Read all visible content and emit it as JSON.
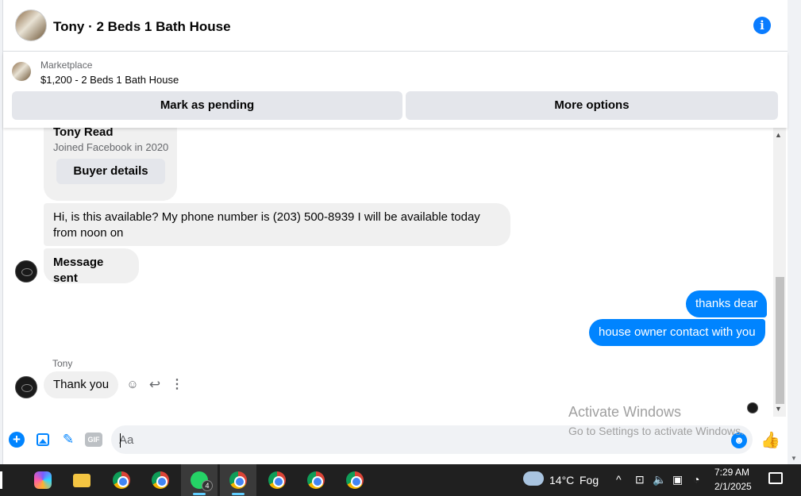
{
  "header": {
    "title": "Tony · 2 Beds 1 Bath House",
    "info_icon": "info-icon"
  },
  "marketplace": {
    "label": "Marketplace",
    "listing": "$1,200 - 2 Beds 1 Bath House",
    "mark_pending": "Mark as pending",
    "more_options": "More options"
  },
  "profile_card": {
    "name": "Tony Read",
    "joined": "Joined Facebook in 2020",
    "buyer_details": "Buyer details"
  },
  "messages": {
    "availability": "Hi, is this available? My phone number is (203) 500-8939 I will be available today from noon on",
    "message_sent": "Message sent",
    "thanks_dear": "thanks dear",
    "house_owner": "house owner contact with you",
    "sender_name": "Tony",
    "thank_you": "Thank you"
  },
  "composer": {
    "placeholder": "Aa",
    "gif_label": "GIF"
  },
  "watermark": {
    "title": "Activate Windows",
    "subtitle": "Go to Settings to activate Windows."
  },
  "taskbar": {
    "whatsapp_badge": "4",
    "temperature": "14°C",
    "condition": "Fog",
    "time": "7:29 AM",
    "date": "2/1/2025"
  },
  "colors": {
    "accent": "#0084ff",
    "incoming_bubble": "#f0f0f0",
    "taskbar": "#202020"
  }
}
